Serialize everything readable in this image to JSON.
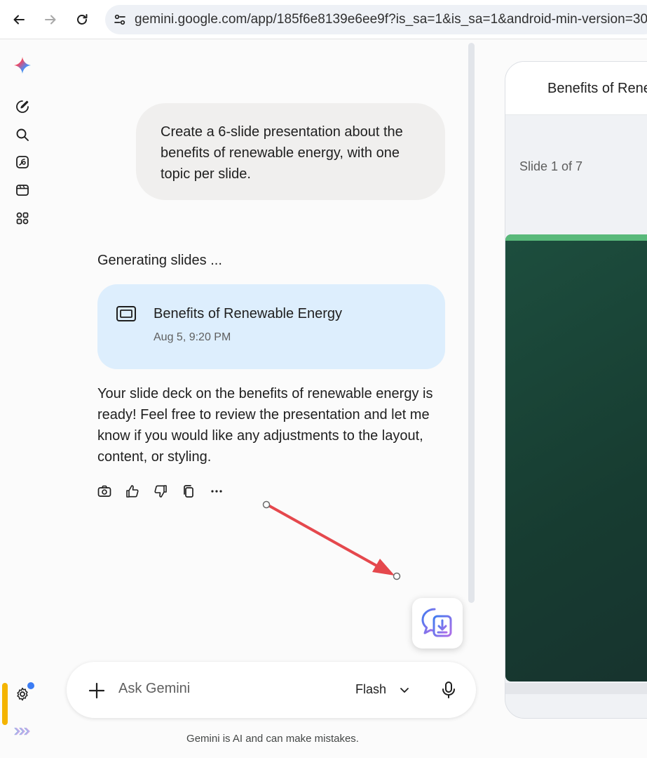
{
  "browser": {
    "url": "gemini.google.com/app/185f6e8139e6ee9f?is_sa=1&is_sa=1&android-min-version=30",
    "back_icon": "arrow-left-icon",
    "forward_icon": "arrow-right-icon",
    "reload_icon": "reload-icon",
    "site_info_icon": "tune-icon"
  },
  "rail": {
    "items": [
      "gemini-logo-icon",
      "new-chat-icon",
      "search-icon",
      "gallery-icon",
      "video-icon",
      "apps-icon"
    ],
    "settings_icon": "gear-icon",
    "bottom_logo": "logo-icon"
  },
  "chat": {
    "user_message": "Create a 6-slide presentation about the benefits of renewable energy, with one topic per slide.",
    "status": "Generating slides ...",
    "card": {
      "title": "Benefits of Renewable Energy",
      "date": "Aug 5, 9:20 PM",
      "icon": "slides-icon"
    },
    "reply": "Your slide deck on the benefits of renewable energy is ready! Feel free to review the presentation and let me know if you would like any adjustments to the layout, content, or styling.",
    "actions": [
      "camera-icon",
      "thumbs-up-icon",
      "thumbs-down-icon",
      "copy-icon",
      "more-icon"
    ]
  },
  "input": {
    "placeholder": "Ask Gemini",
    "model": "Flash",
    "disclaimer": "Gemini is AI and can make mistakes."
  },
  "panel": {
    "title": "Benefits of Renewable Energy",
    "slide_counter": "Slide 1 of 7"
  },
  "colors": {
    "card_bg": "#ddeefd",
    "user_bubble_bg": "#f0efee",
    "slide_bg": "#1d4e3e",
    "slide_stripe": "#59b97a",
    "annotation_arrow": "#e5484d"
  }
}
